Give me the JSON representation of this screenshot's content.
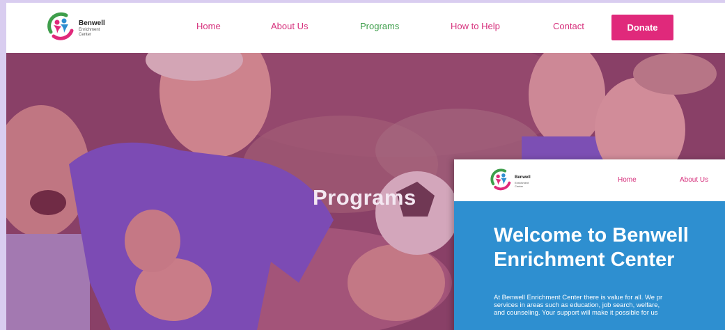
{
  "site": {
    "logo": {
      "name": "Benwell",
      "sub1": "Enrichment",
      "sub2": "Center"
    },
    "nav": [
      {
        "label": "Home"
      },
      {
        "label": "About Us"
      },
      {
        "label": "Programs",
        "active": true
      },
      {
        "label": "How to Help"
      },
      {
        "label": "Contact"
      }
    ],
    "donate_label": "Donate"
  },
  "hero": {
    "title": "Programs",
    "photo": "seniors-celebrating-with-soccer-ball"
  },
  "inset": {
    "logo": {
      "name": "Benwell",
      "sub1": "Enrichment",
      "sub2": "Center"
    },
    "nav": [
      {
        "label": "Home"
      },
      {
        "label": "About Us"
      }
    ],
    "title_line1": "Welcome to Benwell",
    "title_line2": "Enrichment Center",
    "body": [
      "At Benwell Enrichment Center there is value for all. We pr",
      "services in areas such as education, job search, welfare,",
      "and counseling. Your support will make it possible for us"
    ]
  },
  "colors": {
    "brand_pink": "#e0297b",
    "nav_link": "#d6307c",
    "nav_active": "#3e9e4b",
    "inset_blue": "#2e8fd0",
    "page_bg": "#d9cdf0"
  }
}
